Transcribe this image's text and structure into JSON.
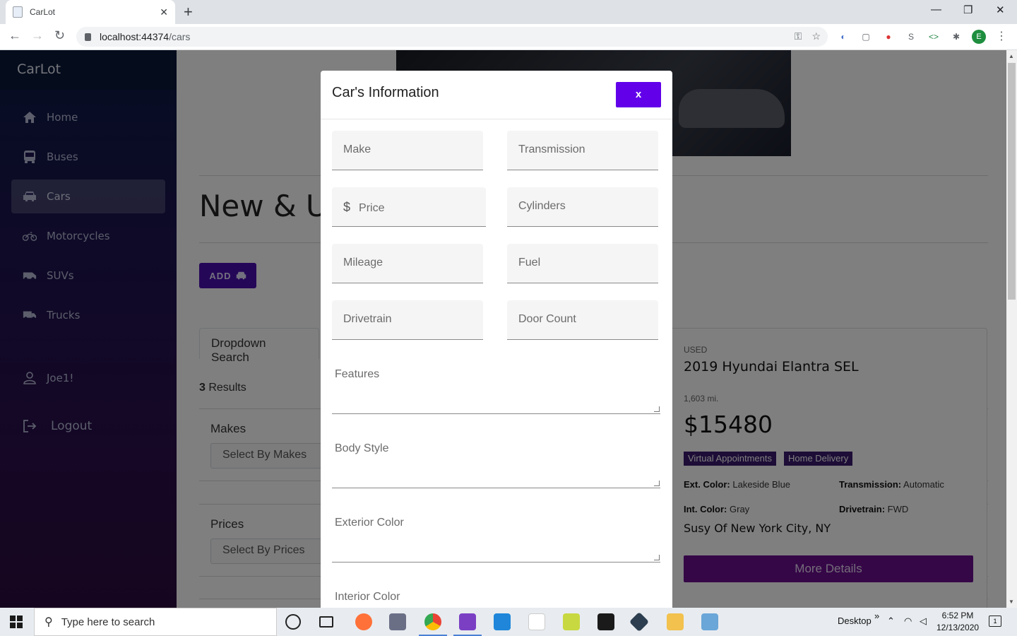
{
  "browser": {
    "tab_title": "CarLot",
    "url_host": "localhost:44374",
    "url_path": "/cars",
    "profile_initial": "E"
  },
  "app": {
    "brand": "CarLot",
    "sidebar": [
      {
        "label": "Home",
        "icon": "home-icon"
      },
      {
        "label": "Buses",
        "icon": "bus-icon"
      },
      {
        "label": "Cars",
        "icon": "car-icon",
        "active": true
      },
      {
        "label": "Motorcycles",
        "icon": "motorcycle-icon"
      },
      {
        "label": "SUVs",
        "icon": "suv-icon"
      },
      {
        "label": "Trucks",
        "icon": "truck-icon"
      }
    ],
    "user": {
      "label": "Joe1!",
      "icon": "user-icon"
    },
    "logout": {
      "label": "Logout",
      "icon": "logout-icon"
    }
  },
  "main": {
    "page_title": "New & Us",
    "add_button": "ADD",
    "search_tab": "Dropdown Search",
    "results_count": "3",
    "results_label": " Results",
    "filters": [
      {
        "label": "Makes",
        "placeholder": "Select By Makes"
      },
      {
        "label": "Prices",
        "placeholder": "Select By Prices"
      }
    ]
  },
  "card": {
    "condition": "USED",
    "title": "2019 Hyundai Elantra SEL",
    "mileage": "1,603 mi.",
    "price": "$15480",
    "badges": [
      "Virtual Appointments",
      "Home Delivery"
    ],
    "specs": [
      {
        "label": "Ext. Color:",
        "value": "Lakeside Blue"
      },
      {
        "label": "Transmission:",
        "value": "Automatic"
      },
      {
        "label": "Int. Color:",
        "value": "Gray"
      },
      {
        "label": "Drivetrain:",
        "value": "FWD"
      }
    ],
    "dealer": "Susy Of New York City, NY",
    "details_button": "More Details"
  },
  "modal": {
    "title": "Car's Information",
    "close_label": "x",
    "fields": [
      {
        "label": "Make"
      },
      {
        "label": "Transmission"
      },
      {
        "label": "Price"
      },
      {
        "label": "Cylinders"
      },
      {
        "label": "Mileage"
      },
      {
        "label": "Fuel"
      },
      {
        "label": "Drivetrain"
      },
      {
        "label": "Door Count"
      }
    ],
    "textareas": [
      {
        "label": "Features"
      },
      {
        "label": "Body Style"
      },
      {
        "label": "Exterior Color"
      },
      {
        "label": "Interior Color"
      }
    ]
  },
  "taskbar": {
    "search_placeholder": "Type here to search",
    "desktop_label": "Desktop",
    "time": "6:52 PM",
    "date": "12/13/2020",
    "notification_count": "1"
  },
  "colors": {
    "accent": "#6200ea",
    "add_button": "#4a0fb0",
    "details_button": "#6a0e8e",
    "badge": "#3a1a6e"
  }
}
